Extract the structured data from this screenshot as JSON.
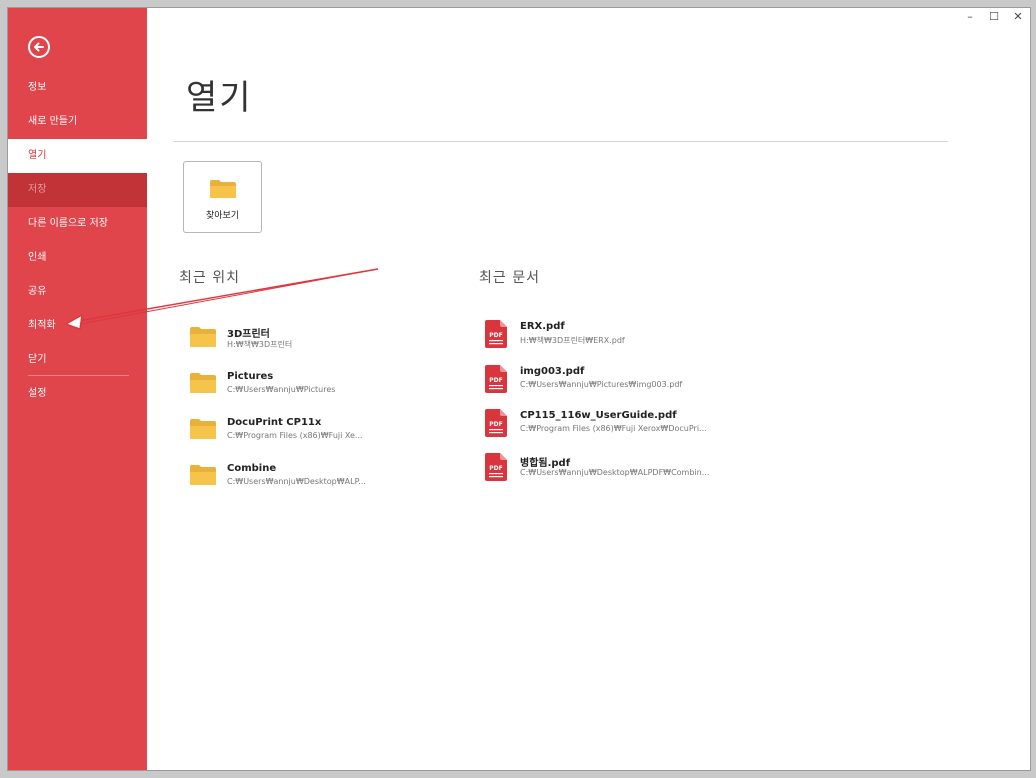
{
  "window": {
    "controls": [
      "–",
      "☐",
      "✕"
    ]
  },
  "sidebar": {
    "back_icon": "back-arrow-circle-icon",
    "items": [
      {
        "label": "정보"
      },
      {
        "label": "새로 만들기"
      },
      {
        "label": "열기"
      },
      {
        "label": "저장"
      },
      {
        "label": "다른 이름으로 저장"
      },
      {
        "label": "인쇄"
      },
      {
        "label": "공유"
      },
      {
        "label": "최적화"
      },
      {
        "label": "닫기"
      },
      {
        "label": "설정"
      }
    ],
    "selected": "열기",
    "disabled": "저장"
  },
  "main": {
    "title": "열기",
    "browse_label": "찾아보기",
    "recent_places_title": "최근 위치",
    "recent_docs_title": "최근 문서",
    "recent_places": [
      {
        "name": "3D프린터",
        "path": "H:₩책₩3D프린터"
      },
      {
        "name": "Pictures",
        "path": "C:₩Users₩annju₩Pictures"
      },
      {
        "name": "DocuPrint CP11x",
        "path": "C:₩Program Files (x86)₩Fuji Xe..."
      },
      {
        "name": "Combine",
        "path": "C:₩Users₩annju₩Desktop₩ALP..."
      }
    ],
    "recent_docs": [
      {
        "name": "ERX.pdf",
        "path": "H:₩책₩3D프린터₩ERX.pdf"
      },
      {
        "name": "img003.pdf",
        "path": "C:₩Users₩annju₩Pictures₩img003.pdf"
      },
      {
        "name": "CP115_116w_UserGuide.pdf",
        "path": "C:₩Program Files (x86)₩Fuji Xerox₩DocuPri..."
      },
      {
        "name": "병합됨.pdf",
        "path": "C:₩Users₩annju₩Desktop₩ALPDF₩Combin..."
      }
    ]
  },
  "colors": {
    "sidebar": "#df454b",
    "sidebar_disabled": "#c23338",
    "accent": "#d8333a",
    "folder": "#f6c44a",
    "pdf": "#d9353c",
    "annotation_arrow": "#e0353c"
  }
}
